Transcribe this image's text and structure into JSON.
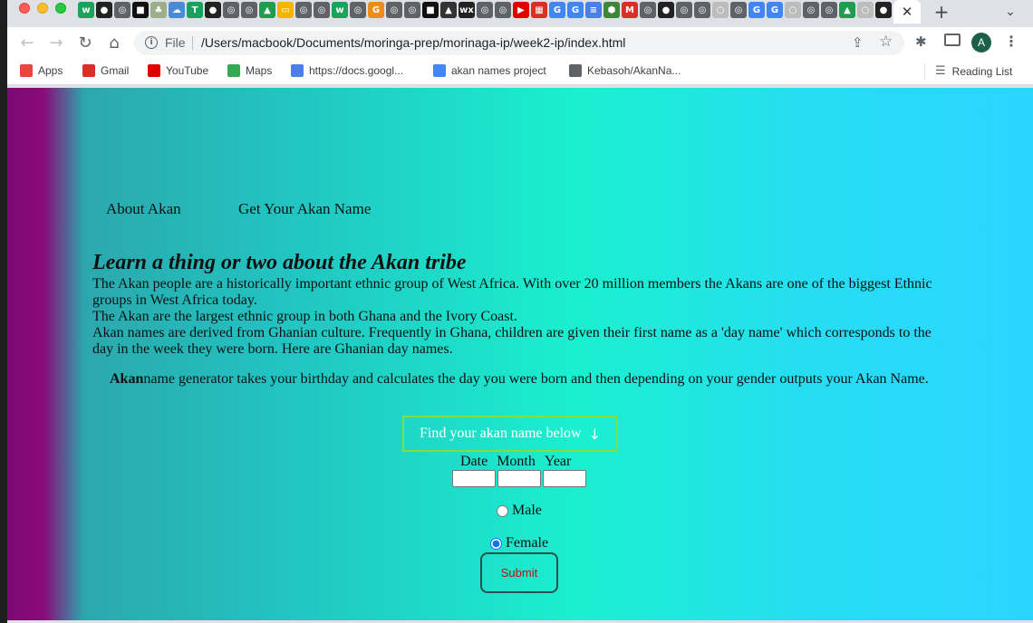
{
  "browser": {
    "tabs": {
      "favicons": [
        {
          "icon": "wix-w-icon",
          "color": "#1aa35a",
          "glyph": "w"
        },
        {
          "icon": "github-icon",
          "color": "#222222",
          "glyph": "●"
        },
        {
          "icon": "globe-icon",
          "color": "#5f6368",
          "glyph": "◎"
        },
        {
          "icon": "moringa-icon",
          "color": "#111111",
          "glyph": "■"
        },
        {
          "icon": "tree-icon",
          "color": "#9bb08a",
          "glyph": "♣"
        },
        {
          "icon": "cloud-icon",
          "color": "#4a8ad6",
          "glyph": "☁"
        },
        {
          "icon": "t-icon",
          "color": "#19a15f",
          "glyph": "T"
        },
        {
          "icon": "github-icon",
          "color": "#222222",
          "glyph": "●"
        },
        {
          "icon": "globe-icon",
          "color": "#5f6368",
          "glyph": "◎"
        },
        {
          "icon": "globe-icon",
          "color": "#5f6368",
          "glyph": "◎"
        },
        {
          "icon": "drive-icon",
          "color": "#1f9c4d",
          "glyph": "▲"
        },
        {
          "icon": "slides-icon",
          "color": "#f4b400",
          "glyph": "▭"
        },
        {
          "icon": "globe-icon",
          "color": "#5f6368",
          "glyph": "◎"
        },
        {
          "icon": "globe-icon",
          "color": "#5f6368",
          "glyph": "◎"
        },
        {
          "icon": "wix-w-icon",
          "color": "#1aa35a",
          "glyph": "w"
        },
        {
          "icon": "globe-icon",
          "color": "#5f6368",
          "glyph": "◎"
        },
        {
          "icon": "orange-app-icon",
          "color": "#f08c1a",
          "glyph": "G"
        },
        {
          "icon": "globe-icon",
          "color": "#5f6368",
          "glyph": "◎"
        },
        {
          "icon": "globe-icon",
          "color": "#5f6368",
          "glyph": "◎"
        },
        {
          "icon": "moringa-icon",
          "color": "#111111",
          "glyph": "■"
        },
        {
          "icon": "ghost-icon",
          "color": "#333333",
          "glyph": "▲"
        },
        {
          "icon": "wix-icon",
          "color": "#222222",
          "glyph": "wx"
        },
        {
          "icon": "chrome-icon",
          "color": "#5f6368",
          "glyph": "◎"
        },
        {
          "icon": "globe-icon",
          "color": "#5f6368",
          "glyph": "◎"
        },
        {
          "icon": "youtube-icon",
          "color": "#e00000",
          "glyph": "▶"
        },
        {
          "icon": "colorful-icon",
          "color": "#d93025",
          "glyph": "▦"
        },
        {
          "icon": "google-icon",
          "color": "#4285f4",
          "glyph": "G"
        },
        {
          "icon": "google-icon",
          "color": "#4285f4",
          "glyph": "G"
        },
        {
          "icon": "docs-icon",
          "color": "#4a7ee8",
          "glyph": "≡"
        },
        {
          "icon": "node-icon",
          "color": "#3c873a",
          "glyph": "⬢"
        },
        {
          "icon": "gmail-icon",
          "color": "#d93025",
          "glyph": "M"
        },
        {
          "icon": "globe-icon",
          "color": "#5f6368",
          "glyph": "◎"
        },
        {
          "icon": "github-icon",
          "color": "#222222",
          "glyph": "●"
        },
        {
          "icon": "globe-icon",
          "color": "#5f6368",
          "glyph": "◎"
        },
        {
          "icon": "globe-icon",
          "color": "#5f6368",
          "glyph": "◎"
        },
        {
          "icon": "blank-icon",
          "color": "#bdbdbd",
          "glyph": "○"
        },
        {
          "icon": "globe-icon",
          "color": "#5f6368",
          "glyph": "◎"
        },
        {
          "icon": "google-icon",
          "color": "#4285f4",
          "glyph": "G"
        },
        {
          "icon": "google-icon",
          "color": "#4285f4",
          "glyph": "G"
        },
        {
          "icon": "blank-icon",
          "color": "#bdbdbd",
          "glyph": "○"
        },
        {
          "icon": "globe-icon",
          "color": "#5f6368",
          "glyph": "◎"
        },
        {
          "icon": "globe-icon",
          "color": "#5f6368",
          "glyph": "◎"
        },
        {
          "icon": "drive-icon",
          "color": "#1f9c4d",
          "glyph": "▲"
        },
        {
          "icon": "blank-icon",
          "color": "#bdbdbd",
          "glyph": "○"
        },
        {
          "icon": "github-icon",
          "color": "#222222",
          "glyph": "●"
        },
        {
          "icon": "globe-icon",
          "color": "#5f6368",
          "glyph": "◎"
        }
      ],
      "active_close_glyph": "✕",
      "new_tab_glyph": "+",
      "tab_search_glyph": "⌄"
    },
    "toolbar": {
      "back_glyph": "←",
      "forward_glyph": "→",
      "reload_glyph": "↻",
      "home_glyph": "⌂",
      "info_glyph": "i",
      "file_label": "File",
      "url": "/Users/macbook/Documents/moringa-prep/morinaga-ip/week2-ip/index.html",
      "share_glyph": "⇪",
      "star_glyph": "☆",
      "extensions_glyph": "✱",
      "avatar_letter": "A",
      "menu_glyph": "⋮"
    },
    "bookmarks": [
      {
        "label": "Apps",
        "icon": "apps-grid-icon",
        "color": "#e8453c"
      },
      {
        "label": "Gmail",
        "icon": "gmail-icon",
        "color": "#d93025"
      },
      {
        "label": "YouTube",
        "icon": "youtube-icon",
        "color": "#e00000"
      },
      {
        "label": "Maps",
        "icon": "maps-icon",
        "color": "#34a853"
      },
      {
        "label": "https://docs.googl...",
        "icon": "docs-icon",
        "color": "#4a7ee8"
      },
      {
        "label": "akan names project",
        "icon": "google-icon",
        "color": "#4285f4"
      },
      {
        "label": "Kebasoh/AkanNa...",
        "icon": "globe-icon",
        "color": "#5f6368"
      }
    ],
    "reading_list": "Reading List"
  },
  "page": {
    "nav": {
      "about": "About Akan",
      "get_name": "Get Your Akan Name"
    },
    "intro": {
      "heading": "Learn a thing or two about the Akan tribe",
      "paragraphs": [
        "The Akan people are a historically important ethnic group of West Africa. With over 20 million members the Akans are one of the biggest Ethnic groups in West Africa today.",
        "The Akan are the largest ethnic group in both Ghana and the Ivory Coast.",
        "Akan names are derived from Ghanian culture. Frequently in Ghana, children are given their first name as a 'day name' which corresponds to the day in the week they were born. Here are Ghanian day names."
      ]
    },
    "generator": {
      "bold": "Akan",
      "rest": "name generator takes your birthday and calculates the day you were born and then depending on your gender outputs your Akan Name."
    },
    "form": {
      "title": "Find your akan name below",
      "title_arrow": "↓",
      "date_label": "Date",
      "month_label": "Month",
      "year_label": "Year",
      "date_value": "",
      "month_value": "",
      "year_value": "",
      "male_label": "Male",
      "female_label": "Female",
      "selected_gender": "Female",
      "submit_label": "Submit"
    },
    "colors": {
      "gradient_left": "#7b0a74",
      "gradient_mid": "#1af0cf",
      "gradient_right": "#2ad6ff",
      "form_title_border": "#7ee03a",
      "submit_text": "#b11111"
    }
  }
}
